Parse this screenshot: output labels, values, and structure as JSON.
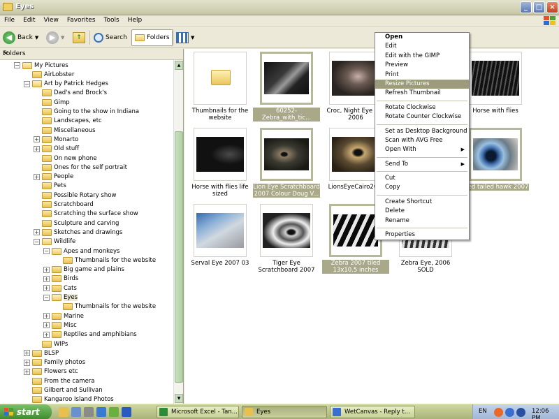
{
  "window": {
    "title": "Eyes"
  },
  "menubar": [
    "File",
    "Edit",
    "View",
    "Favorites",
    "Tools",
    "Help"
  ],
  "toolbar": {
    "back": "Back",
    "search": "Search",
    "folders": "Folders"
  },
  "folders_pane": {
    "title": "Folders",
    "close": "×",
    "tree": [
      {
        "label": "My Pictures",
        "level": 0,
        "expander": "minus",
        "open": true
      },
      {
        "label": "AirLobster",
        "level": 1,
        "expander": "none"
      },
      {
        "label": "Art by Patrick Hedges",
        "level": 1,
        "expander": "minus",
        "open": true
      },
      {
        "label": "Dad's and Brock's",
        "level": 2,
        "expander": "none"
      },
      {
        "label": "Gimp",
        "level": 2,
        "expander": "none"
      },
      {
        "label": "Going to the show in Indiana",
        "level": 2,
        "expander": "none"
      },
      {
        "label": "Landscapes, etc",
        "level": 2,
        "expander": "none"
      },
      {
        "label": "Miscellaneous",
        "level": 2,
        "expander": "none"
      },
      {
        "label": "Monarto",
        "level": 2,
        "expander": "plus"
      },
      {
        "label": "Old stuff",
        "level": 2,
        "expander": "plus"
      },
      {
        "label": "On new phone",
        "level": 2,
        "expander": "none"
      },
      {
        "label": "Ones for the self portrait",
        "level": 2,
        "expander": "none"
      },
      {
        "label": "People",
        "level": 2,
        "expander": "plus"
      },
      {
        "label": "Pets",
        "level": 2,
        "expander": "none"
      },
      {
        "label": "Possible Rotary show",
        "level": 2,
        "expander": "none"
      },
      {
        "label": "Scratchboard",
        "level": 2,
        "expander": "none"
      },
      {
        "label": "Scratching the surface show",
        "level": 2,
        "expander": "none"
      },
      {
        "label": "Sculpture and carving",
        "level": 2,
        "expander": "none"
      },
      {
        "label": "Sketches and drawings",
        "level": 2,
        "expander": "plus"
      },
      {
        "label": "Wildlife",
        "level": 2,
        "expander": "minus",
        "open": true
      },
      {
        "label": "Apes and monkeys",
        "level": 3,
        "expander": "minus",
        "open": true
      },
      {
        "label": "Thumbnails for the website",
        "level": 4,
        "expander": "none"
      },
      {
        "label": "Big game and plains",
        "level": 3,
        "expander": "plus"
      },
      {
        "label": "Birds",
        "level": 3,
        "expander": "plus"
      },
      {
        "label": "Cats",
        "level": 3,
        "expander": "plus"
      },
      {
        "label": "Eyes",
        "level": 3,
        "expander": "minus",
        "open": true,
        "selected": true
      },
      {
        "label": "Thumbnails for the website",
        "level": 4,
        "expander": "none"
      },
      {
        "label": "Marine",
        "level": 3,
        "expander": "plus"
      },
      {
        "label": "Misc",
        "level": 3,
        "expander": "plus"
      },
      {
        "label": "Reptiles and amphibians",
        "level": 3,
        "expander": "plus"
      },
      {
        "label": "WIPs",
        "level": 2,
        "expander": "none"
      },
      {
        "label": "BLSP",
        "level": 1,
        "expander": "plus"
      },
      {
        "label": "Family photos",
        "level": 1,
        "expander": "plus"
      },
      {
        "label": "Flowers etc",
        "level": 1,
        "expander": "plus"
      },
      {
        "label": "From the camera",
        "level": 1,
        "expander": "none"
      },
      {
        "label": "Gilbert and Sullivan",
        "level": 1,
        "expander": "none"
      },
      {
        "label": "Kangaroo Island Photos",
        "level": 1,
        "expander": "none"
      }
    ]
  },
  "files": [
    {
      "caption": "Thumbnails for the website",
      "kind": "folder",
      "selected": false
    },
    {
      "caption": "60252-Zebra_with_tic...",
      "kind": "zebra-eye",
      "selected": true
    },
    {
      "caption": "Croc, Night Eye D... 2006",
      "kind": "croc-eye",
      "selected": false
    },
    {
      "caption": "Horse with flies",
      "kind": "horse-eye",
      "selected": false
    },
    {
      "caption": "Horse with flies life sized",
      "kind": "horse-eye-2",
      "selected": false
    },
    {
      "caption": "Lion Eye Scratchboard 2007 Colour Doug V...",
      "kind": "lion-eye",
      "selected": true
    },
    {
      "caption": "LionsEyeCairo20...",
      "kind": "lion-eye-2",
      "selected": false
    },
    {
      "caption": "...ed tailed hawk 2007",
      "kind": "hawk-eye",
      "selected": true
    },
    {
      "caption": "Serval Eye 2007 03",
      "kind": "serval-eye",
      "selected": false
    },
    {
      "caption": "Tiger Eye Scratchboard 2007",
      "kind": "tiger-eye",
      "selected": false
    },
    {
      "caption": "Zebra 2007 tiled 13x10.5 inches",
      "kind": "zebra-stripes",
      "selected": true
    },
    {
      "caption": "Zebra Eye, 2006 SOLD",
      "kind": "zebra-eye-2",
      "selected": false
    }
  ],
  "context_menu": [
    {
      "label": "Open",
      "bold": true
    },
    {
      "label": "Edit"
    },
    {
      "label": "Edit with the GIMP"
    },
    {
      "label": "Preview"
    },
    {
      "label": "Print"
    },
    {
      "label": "Resize Pictures",
      "highlighted": true
    },
    {
      "label": "Refresh Thumbnail"
    },
    {
      "separator": true
    },
    {
      "label": "Rotate Clockwise"
    },
    {
      "label": "Rotate Counter Clockwise"
    },
    {
      "separator": true
    },
    {
      "label": "Set as Desktop Background"
    },
    {
      "label": "Scan with AVG Free"
    },
    {
      "label": "Open With",
      "submenu": true
    },
    {
      "separator": true
    },
    {
      "label": "Send To",
      "submenu": true
    },
    {
      "separator": true
    },
    {
      "label": "Cut"
    },
    {
      "label": "Copy"
    },
    {
      "separator": true
    },
    {
      "label": "Create Shortcut"
    },
    {
      "label": "Delete"
    },
    {
      "label": "Rename"
    },
    {
      "separator": true
    },
    {
      "label": "Properties"
    }
  ],
  "taskbar": {
    "start": "start",
    "tasks": [
      {
        "label": "Microsoft Excel - Tan...",
        "active": false,
        "icon_color": "#2e8b3a"
      },
      {
        "label": "Eyes",
        "active": true,
        "icon_color": "#e8c050"
      },
      {
        "label": "WetCanvas - Reply t...",
        "active": false,
        "icon_color": "#3a6fd0"
      }
    ],
    "language": "EN",
    "clock": "12:06 PM"
  }
}
